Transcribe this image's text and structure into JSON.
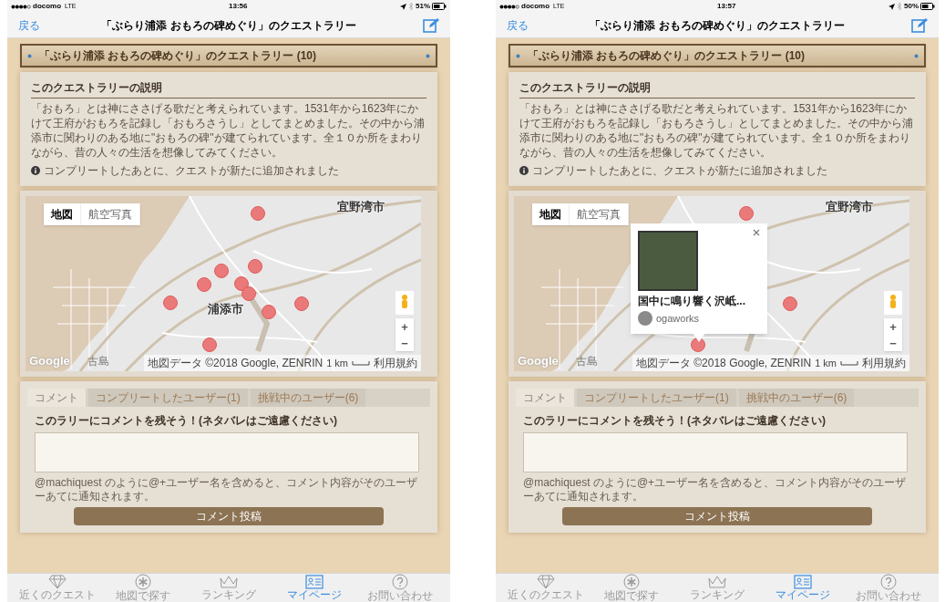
{
  "screens": [
    {
      "status_bar": {
        "carrier": "docomo",
        "network": "LTE",
        "time": "13:56",
        "battery": "51%"
      },
      "nav": {
        "back": "戻る",
        "title": "「ぶらり浦添 おもろの碑めぐり」のクエストラリー"
      },
      "banner": "「ぶらり浦添 おもろの碑めぐり」のクエストラリー (10)",
      "description": {
        "heading": "このクエストラリーの説明",
        "text": "「おもろ」とは神にささげる歌だと考えられています。1531年から1623年にかけて王府がおもろを記録し「おもろさうし」としてまとめました。その中から浦添市に関わりのある地に\"おもろの碑\"が建てられています。全１０か所をまわりながら、昔の人々の生活を想像してみてください。",
        "note": "コンプリートしたあとに、クエストが新たに追加されました"
      },
      "map": {
        "type_buttons": [
          {
            "label": "地図",
            "selected": true
          },
          {
            "label": "航空写真",
            "selected": false
          }
        ],
        "labels": [
          "宜野湾市",
          "浦添市"
        ],
        "zoom_in": "+",
        "zoom_out": "−",
        "logo": "Google",
        "place": "古島",
        "attribution": "地図データ ©2018 Google, ZENRIN",
        "scale": "1 km",
        "terms": "利用規約"
      },
      "comments": {
        "tabs": [
          {
            "label": "コメント",
            "selected": true
          },
          {
            "label": "コンプリートしたユーザー(1)",
            "selected": false
          },
          {
            "label": "挑戦中のユーザー(6)",
            "selected": false
          }
        ],
        "heading": "このラリーにコメントを残そう！(ネタバレはご遠慮ください)",
        "hint": "@machiquest のように@+ユーザー名を含めると、コメント内容がそのユーザーあてに通知されます。",
        "button": "コメント投稿"
      },
      "tab_bar": [
        {
          "label": "近くのクエスト",
          "selected": false
        },
        {
          "label": "地図で探す",
          "selected": false
        },
        {
          "label": "ランキング",
          "selected": false
        },
        {
          "label": "マイページ",
          "selected": true
        },
        {
          "label": "お問い合わせ",
          "selected": false
        }
      ]
    },
    {
      "status_bar": {
        "carrier": "docomo",
        "network": "LTE",
        "time": "13:57",
        "battery": "50%"
      },
      "nav": {
        "back": "戻る",
        "title": "「ぶらり浦添 おもろの碑めぐり」のクエストラリー"
      },
      "banner": "「ぶらり浦添 おもろの碑めぐり」のクエストラリー (10)",
      "description": {
        "heading": "このクエストラリーの説明",
        "text": "「おもろ」とは神にささげる歌だと考えられています。1531年から1623年にかけて王府がおもろを記録し「おもろさうし」としてまとめました。その中から浦添市に関わりのある地に\"おもろの碑\"が建てられています。全１０か所をまわりながら、昔の人々の生活を想像してみてください。",
        "note": "コンプリートしたあとに、クエストが新たに追加されました"
      },
      "map": {
        "type_buttons": [
          {
            "label": "地図",
            "selected": true
          },
          {
            "label": "航空写真",
            "selected": false
          }
        ],
        "labels": [
          "宜野湾市"
        ],
        "zoom_in": "+",
        "zoom_out": "−",
        "logo": "Google",
        "place": "古島",
        "attribution": "地図データ ©2018 Google, ZENRIN",
        "scale": "1 km",
        "terms": "利用規約",
        "popup": {
          "title": "国中に鳴り響く沢岻...",
          "user": "ogaworks"
        }
      },
      "comments": {
        "tabs": [
          {
            "label": "コメント",
            "selected": true
          },
          {
            "label": "コンプリートしたユーザー(1)",
            "selected": false
          },
          {
            "label": "挑戦中のユーザー(6)",
            "selected": false
          }
        ],
        "heading": "このラリーにコメントを残そう！(ネタバレはご遠慮ください)",
        "hint": "@machiquest のように@+ユーザー名を含めると、コメント内容がそのユーザーあてに通知されます。",
        "button": "コメント投稿"
      },
      "tab_bar": [
        {
          "label": "近くのクエスト",
          "selected": false
        },
        {
          "label": "地図で探す",
          "selected": false
        },
        {
          "label": "ランキング",
          "selected": false
        },
        {
          "label": "マイページ",
          "selected": true
        },
        {
          "label": "お問い合わせ",
          "selected": false
        }
      ]
    }
  ]
}
